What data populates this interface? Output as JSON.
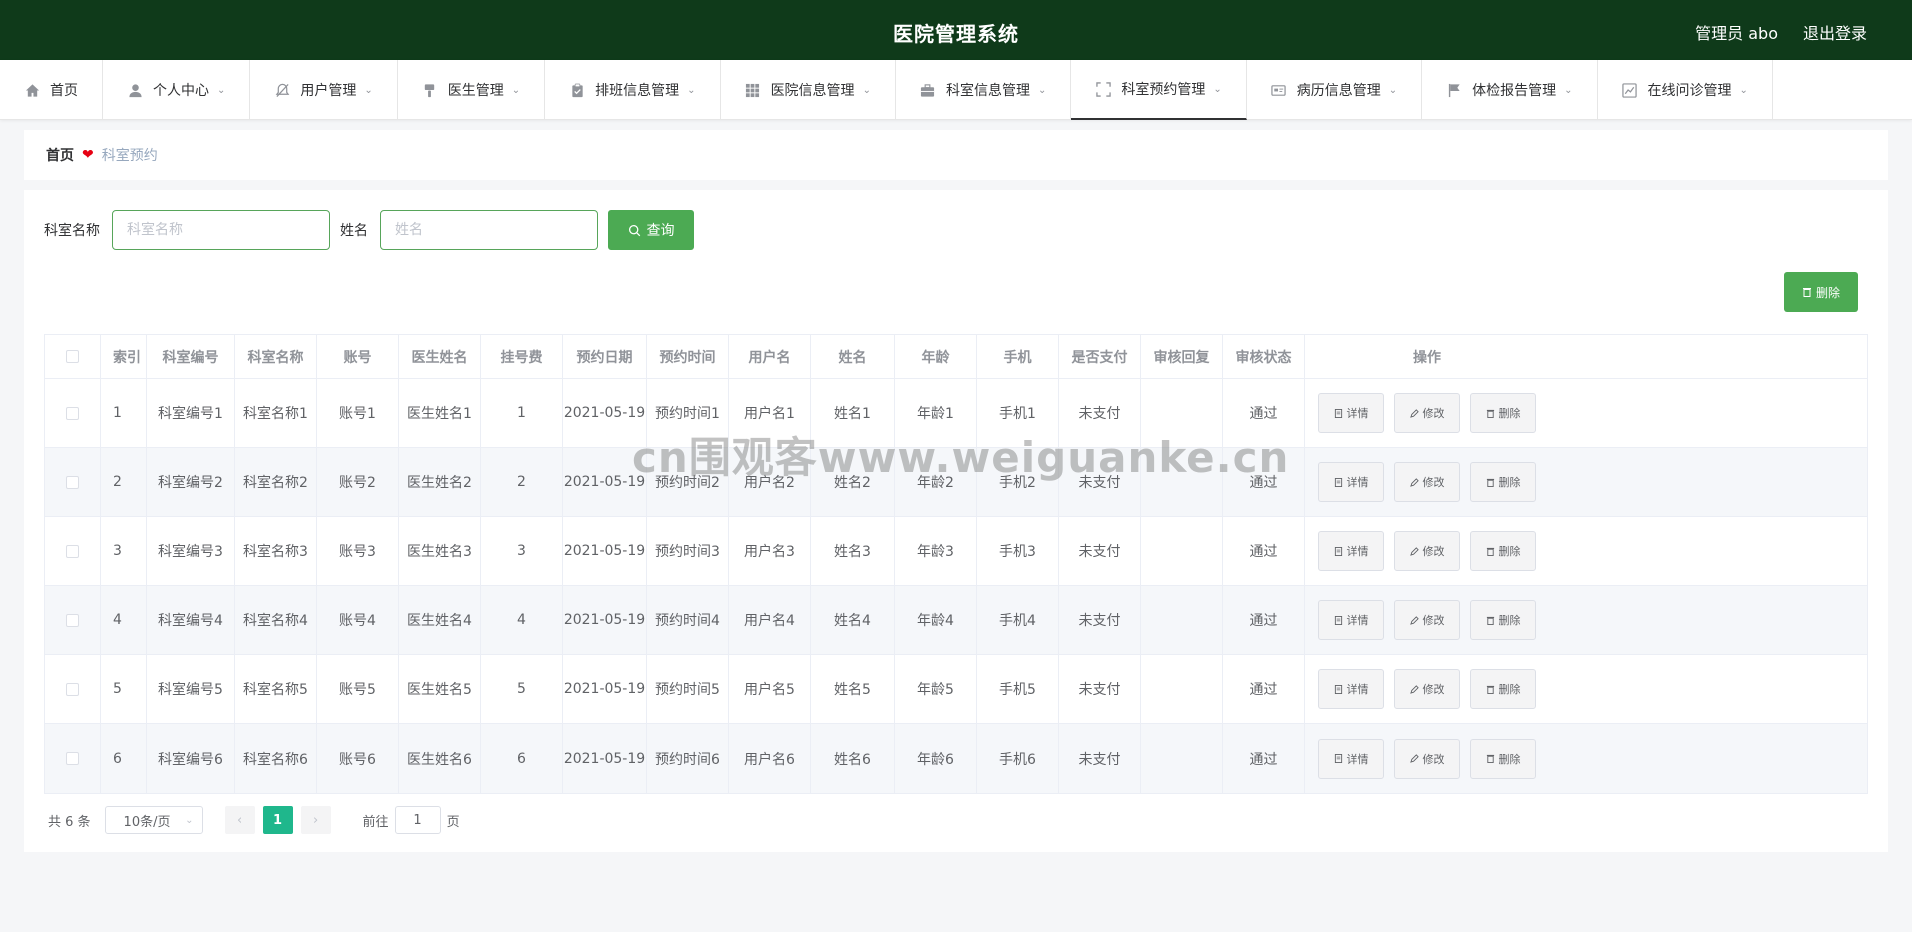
{
  "header": {
    "title": "医院管理系统",
    "user": "管理员 abo",
    "logout": "退出登录"
  },
  "nav": [
    {
      "label": "首页",
      "icon": "home-icon",
      "dropdown": false
    },
    {
      "label": "个人中心",
      "icon": "user-icon",
      "dropdown": true
    },
    {
      "label": "用户管理",
      "icon": "bell-off-icon",
      "dropdown": true
    },
    {
      "label": "医生管理",
      "icon": "brush-icon",
      "dropdown": true
    },
    {
      "label": "排班信息管理",
      "icon": "clipboard-icon",
      "dropdown": true
    },
    {
      "label": "医院信息管理",
      "icon": "grid-icon",
      "dropdown": true
    },
    {
      "label": "科室信息管理",
      "icon": "briefcase-icon",
      "dropdown": true
    },
    {
      "label": "科室预约管理",
      "icon": "fullscreen-icon",
      "dropdown": true,
      "active": true
    },
    {
      "label": "病历信息管理",
      "icon": "id-card-icon",
      "dropdown": true
    },
    {
      "label": "体检报告管理",
      "icon": "flag-icon",
      "dropdown": true
    },
    {
      "label": "在线问诊管理",
      "icon": "chart-icon",
      "dropdown": true
    }
  ],
  "breadcrumb": {
    "home": "首页",
    "current": "科室预约"
  },
  "search": {
    "dept_label": "科室名称",
    "dept_placeholder": "科室名称",
    "name_label": "姓名",
    "name_placeholder": "姓名",
    "query_button": "查询"
  },
  "delete_button": "删除",
  "table": {
    "columns": [
      "索引",
      "科室编号",
      "科室名称",
      "账号",
      "医生姓名",
      "挂号费",
      "预约日期",
      "预约时间",
      "用户名",
      "姓名",
      "年龄",
      "手机",
      "是否支付",
      "审核回复",
      "审核状态",
      "操作"
    ],
    "rows": [
      [
        "1",
        "科室编号1",
        "科室名称1",
        "账号1",
        "医生姓名1",
        "1",
        "2021-05-19",
        "预约时间1",
        "用户名1",
        "姓名1",
        "年龄1",
        "手机1",
        "未支付",
        "",
        "通过"
      ],
      [
        "2",
        "科室编号2",
        "科室名称2",
        "账号2",
        "医生姓名2",
        "2",
        "2021-05-19",
        "预约时间2",
        "用户名2",
        "姓名2",
        "年龄2",
        "手机2",
        "未支付",
        "",
        "通过"
      ],
      [
        "3",
        "科室编号3",
        "科室名称3",
        "账号3",
        "医生姓名3",
        "3",
        "2021-05-19",
        "预约时间3",
        "用户名3",
        "姓名3",
        "年龄3",
        "手机3",
        "未支付",
        "",
        "通过"
      ],
      [
        "4",
        "科室编号4",
        "科室名称4",
        "账号4",
        "医生姓名4",
        "4",
        "2021-05-19",
        "预约时间4",
        "用户名4",
        "姓名4",
        "年龄4",
        "手机4",
        "未支付",
        "",
        "通过"
      ],
      [
        "5",
        "科室编号5",
        "科室名称5",
        "账号5",
        "医生姓名5",
        "5",
        "2021-05-19",
        "预约时间5",
        "用户名5",
        "姓名5",
        "年龄5",
        "手机5",
        "未支付",
        "",
        "通过"
      ],
      [
        "6",
        "科室编号6",
        "科室名称6",
        "账号6",
        "医生姓名6",
        "6",
        "2021-05-19",
        "预约时间6",
        "用户名6",
        "姓名6",
        "年龄6",
        "手机6",
        "未支付",
        "",
        "通过"
      ]
    ],
    "actions": {
      "detail": "详情",
      "edit": "修改",
      "delete": "删除"
    }
  },
  "pagination": {
    "total": "共 6 条",
    "page_size": "10条/页",
    "current_page": "1",
    "goto_label": "前往",
    "goto_value": "1",
    "page_suffix": "页"
  },
  "watermark": "cn围观客www.weiguanke.cn"
}
